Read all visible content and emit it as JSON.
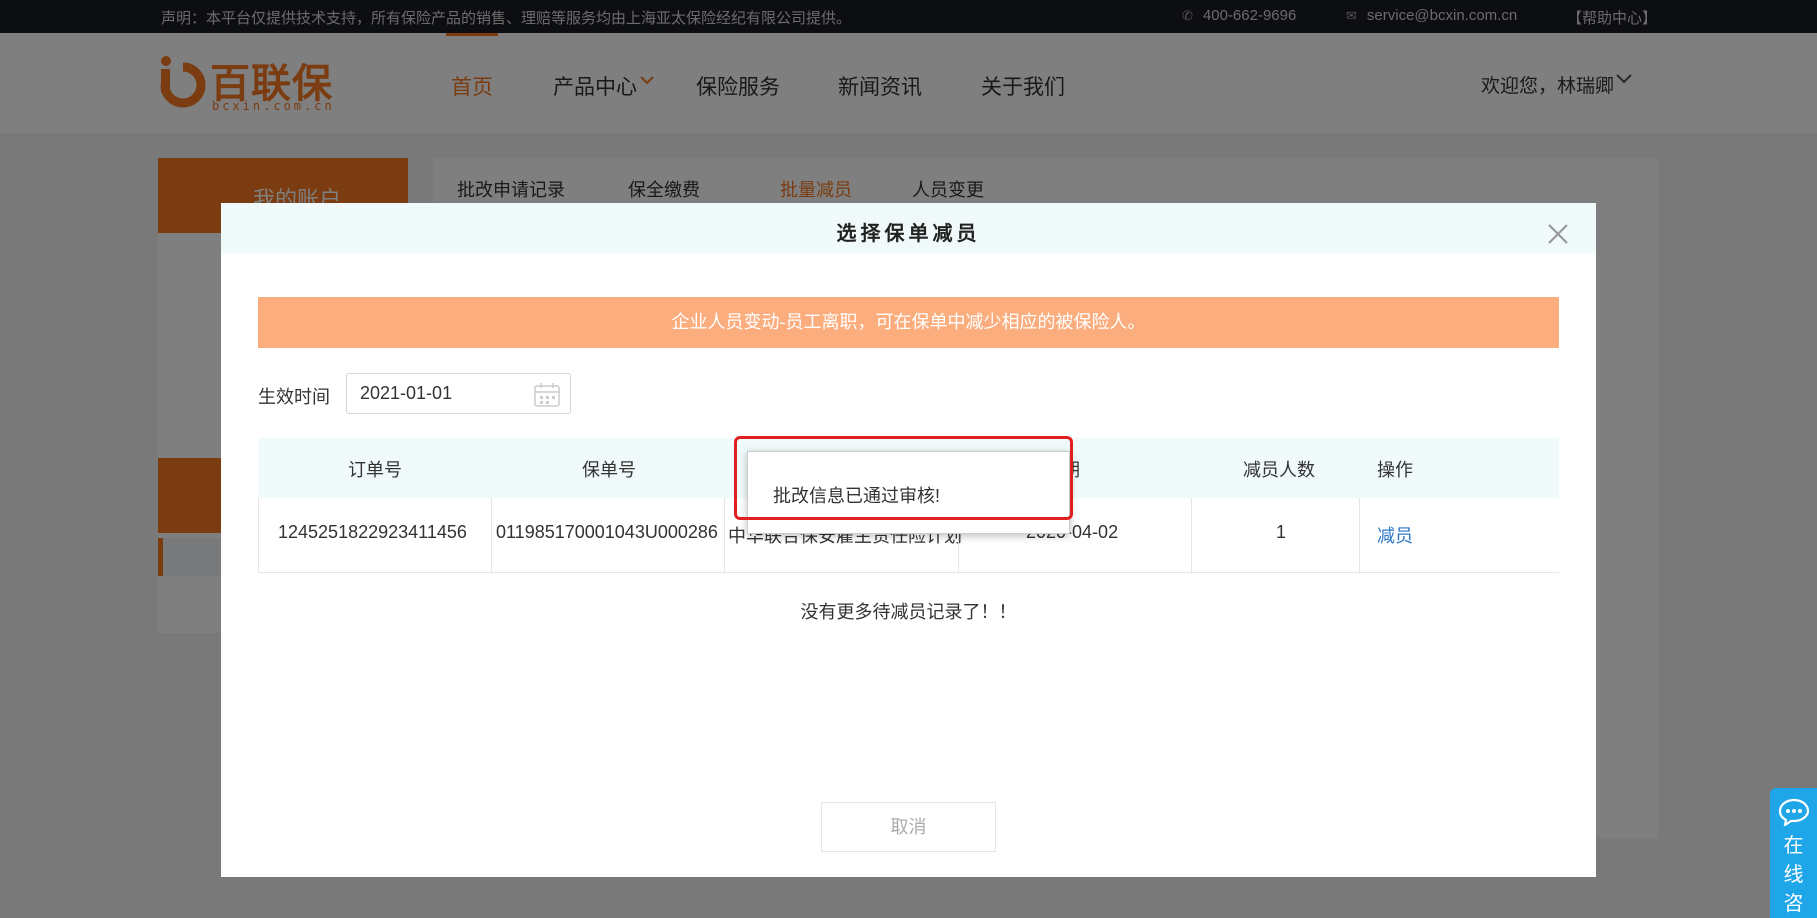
{
  "topbar": {
    "notice": "声明：本平台仅提供技术支持，所有保险产品的销售、理赔等服务均由上海亚太保险经纪有限公司提供。",
    "phone": "400-662-9696",
    "email": "service@bcxin.com.cn",
    "help": "【帮助中心】"
  },
  "logo": {
    "name": "百联保",
    "domain": "bcxin.com.cn"
  },
  "nav": {
    "home": "首页",
    "products": "产品中心",
    "services": "保险服务",
    "news": "新闻资讯",
    "about": "关于我们"
  },
  "user": {
    "greeting": "欢迎您，林瑞卿"
  },
  "sidebar": {
    "account": "我的账户"
  },
  "content_tabs": [
    "批改申请记录",
    "保全缴费",
    "批量减员",
    "人员变更"
  ],
  "modal": {
    "title": "选择保单减员",
    "banner": "企业人员变动-员工离职，可在保单中减少相应的被保险人。",
    "effective_label": "生效时间",
    "effective_date": "2021-01-01",
    "columns": [
      "订单号",
      "保单号",
      "",
      "保日期",
      "减员人数",
      "操作"
    ],
    "row": {
      "order_no": "1245251822923411456",
      "policy_no": "011985170001043U000286",
      "plan": "中华联合保安雇主责任险计划",
      "date": "2020-04-02",
      "count": "1",
      "action": "减员"
    },
    "no_more": "没有更多待减员记录了！！",
    "cancel": "取消"
  },
  "toast": {
    "message": "批改信息已通过审核!"
  },
  "chat": {
    "label": "在线咨"
  },
  "colors": {
    "brand": "#f47920",
    "banner": "#fbad7e",
    "link": "#2c77c8",
    "highlight": "#e02020",
    "chat": "#1fa6e8"
  }
}
